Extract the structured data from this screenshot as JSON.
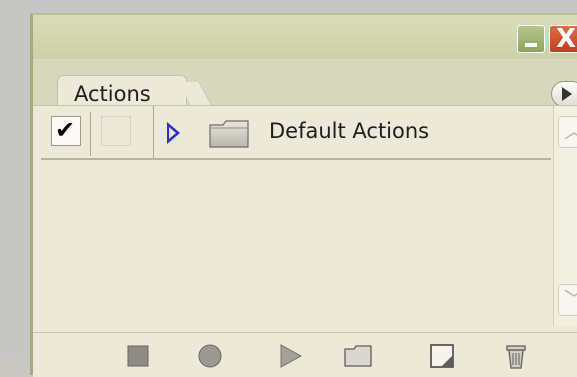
{
  "window": {
    "minimize_icon": "minimize-icon",
    "close_icon": "close-icon",
    "close_glyph": "X"
  },
  "tabs": [
    {
      "label": "Actions"
    }
  ],
  "panel_menu_icon": "panel-menu-icon",
  "actions_list": [
    {
      "label": "Default Actions",
      "type": "action-set",
      "toggle_checked": true,
      "dialog_toggle": false,
      "expanded": false,
      "icon": "folder-icon"
    }
  ],
  "toolbar": {
    "items": [
      {
        "name": "stop-playing-icon"
      },
      {
        "name": "begin-recording-icon"
      },
      {
        "name": "play-selection-icon"
      },
      {
        "name": "create-new-set-icon"
      },
      {
        "name": "create-new-action-icon"
      },
      {
        "name": "delete-icon"
      }
    ]
  },
  "colors": {
    "panel_bg": "#ece9d8",
    "title_bg": "#cdd1a8",
    "close_btn": "#c23d1f",
    "expander": "#2a2ae0"
  }
}
